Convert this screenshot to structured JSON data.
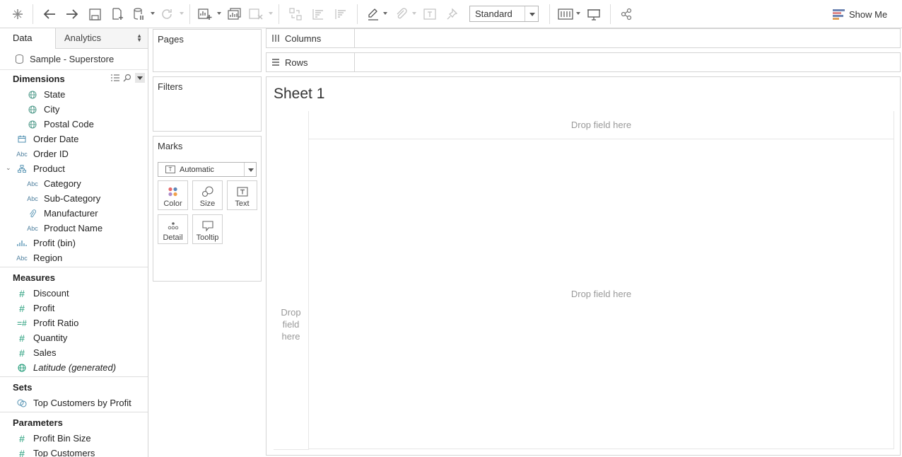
{
  "toolbar": {
    "fit_mode": "Standard",
    "show_me_label": "Show Me",
    "icons": [
      "tableau-logo-icon",
      "undo-icon",
      "redo-icon",
      "save-icon",
      "new-datasource-icon",
      "pause-updates-icon",
      "refresh-icon",
      "new-worksheet-icon",
      "duplicate-sheet-icon",
      "clear-sheet-icon",
      "swap-icon",
      "sort-ascending-icon",
      "sort-descending-icon",
      "highlight-icon",
      "group-icon",
      "show-labels-icon",
      "fix-axes-icon",
      "view-cards-icon",
      "presentation-mode-icon",
      "share-icon"
    ]
  },
  "left_pane": {
    "tab_data": "Data",
    "tab_analytics": "Analytics",
    "datasource": "Sample - Superstore",
    "dimensions_title": "Dimensions",
    "dimensions": [
      {
        "label": "State",
        "icon": "globe",
        "level": 1
      },
      {
        "label": "City",
        "icon": "globe",
        "level": 1
      },
      {
        "label": "Postal Code",
        "icon": "globe",
        "level": 1
      },
      {
        "label": "Order Date",
        "icon": "calendar",
        "level": 0
      },
      {
        "label": "Order ID",
        "icon": "abc",
        "level": 0
      },
      {
        "label": "Product",
        "icon": "hierarchy",
        "level": 0
      },
      {
        "label": "Category",
        "icon": "abc",
        "level": 1
      },
      {
        "label": "Sub-Category",
        "icon": "abc",
        "level": 1
      },
      {
        "label": "Manufacturer",
        "icon": "paperclip",
        "level": 1
      },
      {
        "label": "Product Name",
        "icon": "abc",
        "level": 1
      },
      {
        "label": "Profit (bin)",
        "icon": "bin",
        "level": 0
      },
      {
        "label": "Region",
        "icon": "abc",
        "level": 0
      }
    ],
    "measures_title": "Measures",
    "measures": [
      {
        "label": "Discount",
        "icon": "hash"
      },
      {
        "label": "Profit",
        "icon": "hash"
      },
      {
        "label": "Profit Ratio",
        "icon": "calc-hash"
      },
      {
        "label": "Quantity",
        "icon": "hash"
      },
      {
        "label": "Sales",
        "icon": "hash"
      },
      {
        "label": "Latitude (generated)",
        "icon": "globe"
      }
    ],
    "sets_title": "Sets",
    "sets": [
      {
        "label": "Top Customers by Profit",
        "icon": "set"
      }
    ],
    "parameters_title": "Parameters",
    "parameters": [
      {
        "label": "Profit Bin Size",
        "icon": "hash"
      },
      {
        "label": "Top Customers",
        "icon": "hash"
      }
    ]
  },
  "cards": {
    "pages_title": "Pages",
    "filters_title": "Filters",
    "marks_title": "Marks",
    "marks_type": "Automatic",
    "marks_buttons": {
      "color": "Color",
      "size": "Size",
      "text": "Text",
      "detail": "Detail",
      "tooltip": "Tooltip"
    }
  },
  "shelves": {
    "columns": "Columns",
    "rows": "Rows"
  },
  "sheet": {
    "title": "Sheet 1",
    "drop_top": "Drop field here",
    "drop_left": "Drop\nfield\nhere",
    "drop_main": "Drop field here"
  }
}
